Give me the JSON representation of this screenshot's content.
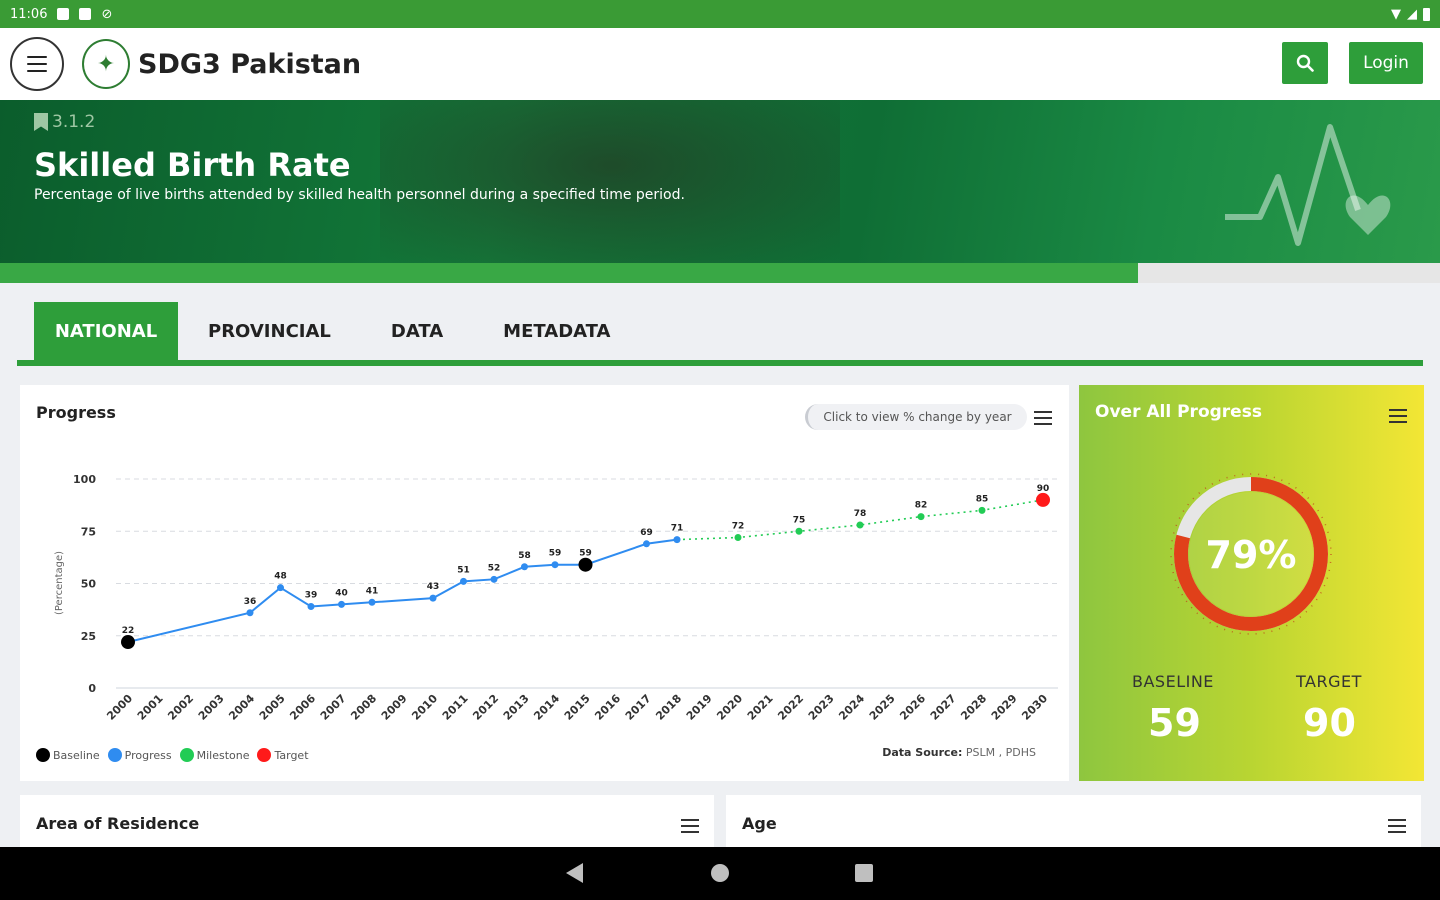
{
  "status_bar": {
    "time": "11:06"
  },
  "header": {
    "app_title": "SDG3 Pakistan",
    "login_label": "Login"
  },
  "hero": {
    "indicator_code": "3.1.2",
    "title": "Skilled Birth Rate",
    "subtitle": "Percentage of live births attended by skilled health personnel during a specified time period.",
    "progress_fraction": 0.79
  },
  "tabs": [
    {
      "label": "NATIONAL",
      "active": true
    },
    {
      "label": "PROVINCIAL",
      "active": false
    },
    {
      "label": "DATA",
      "active": false
    },
    {
      "label": "METADATA",
      "active": false
    }
  ],
  "progress_card": {
    "title": "Progress",
    "toggle_label": "Click to view % change by year",
    "data_source_label": "Data Source:",
    "data_source_value": "PSLM , PDHS",
    "legend": [
      {
        "label": "Baseline",
        "color": "#000000"
      },
      {
        "label": "Progress",
        "color": "#2f8cf0"
      },
      {
        "label": "Milestone",
        "color": "#22cc55"
      },
      {
        "label": "Target",
        "color": "#ff1a1a"
      }
    ]
  },
  "overall_card": {
    "title": "Over All Progress",
    "percent_label": "79%",
    "percent_value": 79,
    "baseline_label": "BASELINE",
    "baseline_value": "59",
    "target_label": "TARGET",
    "target_value": "90",
    "ring_color": "#e0401a"
  },
  "bottom_cards": {
    "residence_title": "Area of Residence",
    "age_title": "Age"
  },
  "chart_data": {
    "type": "line",
    "ylabel": "(Percentage)",
    "ylim": [
      0,
      100
    ],
    "yticks": [
      0,
      25,
      50,
      75,
      100
    ],
    "categories": [
      "2000",
      "2001",
      "2002",
      "2003",
      "2004",
      "2005",
      "2006",
      "2007",
      "2008",
      "2009",
      "2010",
      "2011",
      "2012",
      "2013",
      "2014",
      "2015",
      "2016",
      "2017",
      "2018",
      "2019",
      "2020",
      "2021",
      "2022",
      "2023",
      "2024",
      "2025",
      "2026",
      "2027",
      "2028",
      "2029",
      "2030"
    ],
    "series": [
      {
        "name": "Progress",
        "color": "#2f8cf0",
        "points": [
          [
            2000,
            22
          ],
          [
            2004,
            36
          ],
          [
            2005,
            48
          ],
          [
            2006,
            39
          ],
          [
            2007,
            40
          ],
          [
            2008,
            41
          ],
          [
            2010,
            43
          ],
          [
            2011,
            51
          ],
          [
            2012,
            52
          ],
          [
            2013,
            58
          ],
          [
            2014,
            59
          ],
          [
            2015,
            59
          ],
          [
            2017,
            69
          ],
          [
            2018,
            71
          ]
        ]
      },
      {
        "name": "Milestone",
        "color": "#22cc55",
        "points": [
          [
            2018,
            71
          ],
          [
            2020,
            72
          ],
          [
            2022,
            75
          ],
          [
            2024,
            78
          ],
          [
            2026,
            82
          ],
          [
            2028,
            85
          ],
          [
            2030,
            90
          ]
        ]
      },
      {
        "name": "Baseline",
        "color": "#000000",
        "points": [
          [
            2000,
            22
          ],
          [
            2015,
            59
          ]
        ]
      },
      {
        "name": "Target",
        "color": "#ff1a1a",
        "points": [
          [
            2030,
            90
          ]
        ]
      }
    ]
  }
}
